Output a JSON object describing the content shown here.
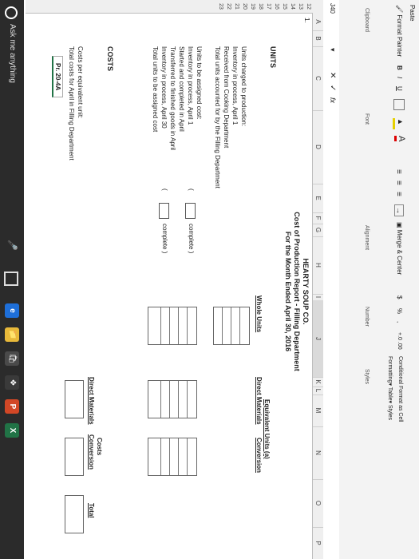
{
  "ribbon": {
    "paste_label": "Paste",
    "format_painter_label": "Format Painter",
    "clipboard_label": "Clipboard",
    "font_label": "Font",
    "bold_label": "B",
    "italic_label": "I",
    "underline_label": "U",
    "alignment_label": "Alignment",
    "merge_center_label": "Merge & Center",
    "number_label": "Number",
    "currency_label": "$",
    "percent_label": "%",
    "comma_label": ",",
    "decimals_label": "+.0 .00",
    "conditional_label": "Conditional Format as Cell",
    "formatting_label": "Formatting▾ Table▾ Styles",
    "styles_label": "Styles"
  },
  "formula_bar": {
    "name_box": "J40",
    "cancel": "✕",
    "enter": "✓",
    "fx": "fx"
  },
  "columns": [
    "A",
    "B",
    "C",
    "D",
    "E",
    "F",
    "G",
    "H",
    "I",
    "J",
    "K",
    "L",
    "M",
    "N",
    "O",
    "P"
  ],
  "rows": [
    "12",
    "13",
    "14",
    "15",
    "16",
    "17",
    "18",
    "19",
    "20",
    "21",
    "22",
    "23"
  ],
  "sheet": {
    "problem_number": "1.",
    "company": "HEARTY SOUP CO.",
    "report_title": "Cost of Production Report - Filling Department",
    "period": "For the Month Ended April 30, 2016",
    "units_heading": "UNITS",
    "whole_units_header": "Whole Units",
    "equiv_units_header": "Equivalent Units (a)",
    "direct_materials_header": "Direct Materials",
    "conversion_header": "Conversion",
    "units_charged_lines": [
      "Units charged to production:",
      "Inventory in process, April 1",
      "Received from Cooking Department",
      "Total units accounted for by the Filling Department"
    ],
    "units_assigned_lines": [
      "Units to be assigned cost:",
      "Inventory in process, April 1",
      "Started and completed in April",
      "Transferred to finished goods in April",
      "Inventory in process, April 30",
      "Total units to be assigned cost"
    ],
    "open_paren": "(",
    "complete_label": "complete )",
    "costs_heading": "COSTS",
    "costs_header": "Costs",
    "total_header": "Total",
    "costs_per_eu_line": "Costs per equivalent unit:",
    "total_costs_line": "Total costs for April in Filling Department",
    "tab_label": "Pr. 20-4A"
  },
  "taskbar": {
    "search_placeholder": "Ask me anything",
    "app_edge": "e",
    "app_ppt": "P",
    "app_excel": "X"
  }
}
